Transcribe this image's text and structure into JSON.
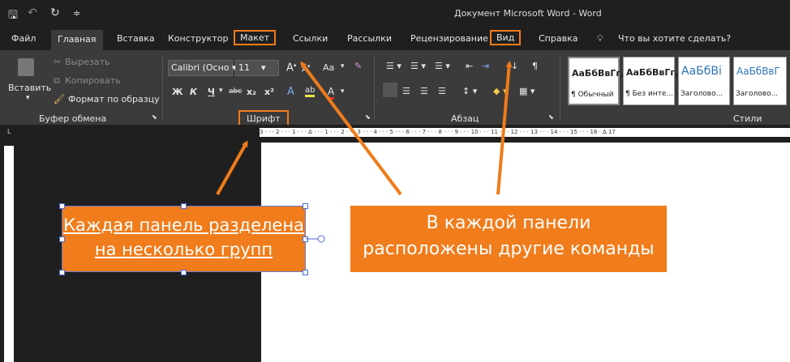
{
  "title": "Документ Microsoft Word  -  Word",
  "tabs": {
    "file": "Файл",
    "home": "Главная",
    "insert": "Вставка",
    "design": "Конструктор",
    "layout": "Макет",
    "references": "Ссылки",
    "mailings": "Рассылки",
    "review": "Рецензирование",
    "view": "Вид",
    "help": "Справка",
    "tellme": "Что вы хотите сделать?"
  },
  "clipboard": {
    "paste": "Вставить",
    "cut": "Вырезать",
    "copy": "Копировать",
    "format_painter": "Формат по образцу",
    "label": "Буфер обмена"
  },
  "font": {
    "name": "Calibri (Осно",
    "size": "11",
    "bold": "Ж",
    "italic": "К",
    "underline": "Ч",
    "strike": "abc",
    "sub": "x₂",
    "sup": "x²",
    "case": "Aa",
    "label": "Шрифт"
  },
  "paragraph": {
    "label": "Абзац",
    "pilcrow": "¶"
  },
  "styles": {
    "label": "Стили",
    "items": [
      {
        "preview": "АаБбВвГг,",
        "name": "¶ Обычный"
      },
      {
        "preview": "АаБбВвГг,",
        "name": "¶ Без инте..."
      },
      {
        "preview": "АаБбВі",
        "name": "Заголово..."
      },
      {
        "preview": "АаБбВвГ",
        "name": "Заголово..."
      }
    ]
  },
  "ruler": {
    "marks": "3 · · · 2 · · · 1 · · · ∆ · · · 1 · · · 2 · · · 3 · · · 4 · · · 5 · · · 6 · · · 7 · · · 8 · · · 9 · · · 10 · · · 11 · · · 12 · · · 13 · · · 14 · · · 15 · · · 16 · ∆ 17"
  },
  "callouts": {
    "left_line1": "Каждая панель разделена",
    "left_line2": "на несколько групп",
    "right_line1": "В каждой панели",
    "right_line2": "расположены другие команды"
  },
  "colors": {
    "accent": "#f07c1b",
    "ribbon": "#3b3b3b",
    "bg": "#1f1f1f"
  }
}
